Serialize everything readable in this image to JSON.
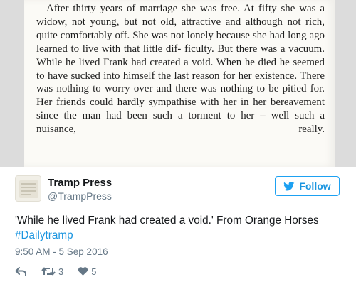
{
  "book_excerpt": {
    "lines": [
      "After thirty years of marriage she was free. At fifty",
      "she was a widow, not young, but not old, attractive and",
      "although not rich, quite comfortably off. She was not lonely",
      "because she had long ago learned to live with that little dif-",
      "ficulty. But there was a vacuum. While he lived Frank had",
      "created a void. When he died he seemed to have sucked into",
      "himself the last reason for her existence. There was nothing",
      "to worry over and there was nothing to be pitied for. Her",
      "friends could hardly sympathise with her in her bereavement",
      "since the man had been such a torment to her – well such a",
      "nuisance, really."
    ]
  },
  "tweet": {
    "display_name": "Tramp Press",
    "handle": "@TrampPress",
    "follow_label": "Follow",
    "text": "'While he lived Frank had created a void.' From Orange Horses",
    "hashtag": "#Dailytramp",
    "timestamp": "9:50 AM - 5 Sep 2016",
    "retweet_count": "3",
    "like_count": "5",
    "icons": {
      "avatar": "tramp-press-logo",
      "follow": "twitter-bird-icon",
      "reply": "reply-icon",
      "retweet": "retweet-icon",
      "like": "heart-icon"
    },
    "colors": {
      "accent": "#1da1f2",
      "link": "#1b95e0",
      "muted": "#657786"
    }
  }
}
